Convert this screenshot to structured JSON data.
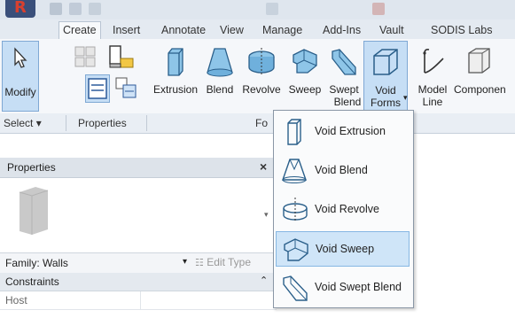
{
  "tabs": [
    "Create",
    "Insert",
    "Annotate",
    "View",
    "Manage",
    "Add-Ins",
    "Vault",
    "SODIS Labs"
  ],
  "ribbon": {
    "modify": "Modify",
    "extrusion": "Extrusion",
    "blend": "Blend",
    "revolve": "Revolve",
    "sweep": "Sweep",
    "swept_blend_line1": "Swept",
    "swept_blend_line2": "Blend",
    "void_forms_line1": "Void",
    "void_forms_line2": "Forms",
    "model_line_line1": "Model",
    "model_line_line2": "Line",
    "component": "Componen"
  },
  "panelbar": {
    "select": "Select",
    "select_arrow": "▾",
    "properties": "Properties",
    "forms_partial": "Fo"
  },
  "properties": {
    "title": "Properties",
    "close": "×",
    "family": "Family: Walls",
    "edit_type": "Edit Type",
    "constraints": "Constraints",
    "collapse": "⌃",
    "host": "Host"
  },
  "void_menu": [
    {
      "label": "Void Extrusion",
      "icon": "void-extrusion-icon"
    },
    {
      "label": "Void Blend",
      "icon": "void-blend-icon"
    },
    {
      "label": "Void Revolve",
      "icon": "void-revolve-icon"
    },
    {
      "label": "Void Sweep",
      "icon": "void-sweep-icon"
    },
    {
      "label": "Void Swept Blend",
      "icon": "void-swept-blend-icon"
    }
  ],
  "colors": {
    "pressed_bg": "#c6def5",
    "hover_bg": "#cfe5f8",
    "app_red": "#d8402f"
  }
}
